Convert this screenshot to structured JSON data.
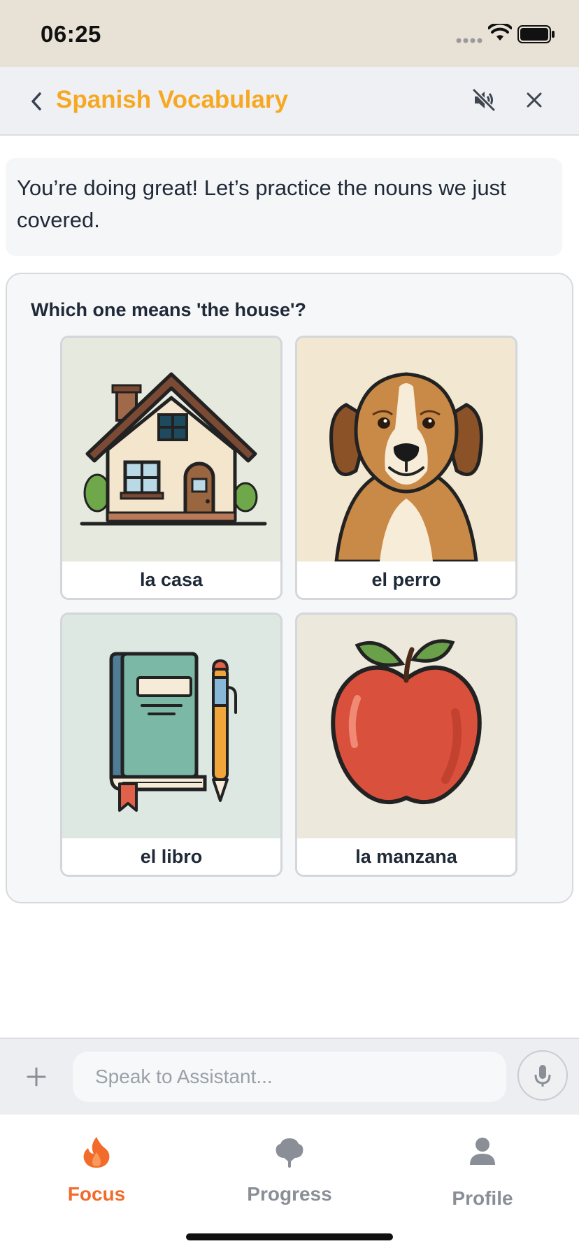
{
  "status_bar": {
    "time": "06:25"
  },
  "header": {
    "title": "Spanish Vocabulary"
  },
  "message": {
    "text": "You’re doing great! Let’s practice the nouns we just covered."
  },
  "quiz": {
    "question": "Which one means 'the house'?",
    "options": [
      {
        "label": "la casa",
        "icon": "house-illustration"
      },
      {
        "label": "el perro",
        "icon": "dog-illustration"
      },
      {
        "label": "el libro",
        "icon": "book-illustration"
      },
      {
        "label": "la manzana",
        "icon": "apple-illustration"
      }
    ]
  },
  "input": {
    "placeholder": "Speak to Assistant..."
  },
  "tabs": [
    {
      "label": "Focus",
      "icon": "flame-icon",
      "active": true
    },
    {
      "label": "Progress",
      "icon": "tree-icon",
      "active": false
    },
    {
      "label": "Profile",
      "icon": "person-icon",
      "active": false
    }
  ],
  "colors": {
    "accent": "#f7a823",
    "tab_active": "#f26b2a",
    "tab_inactive": "#8a8f97"
  }
}
